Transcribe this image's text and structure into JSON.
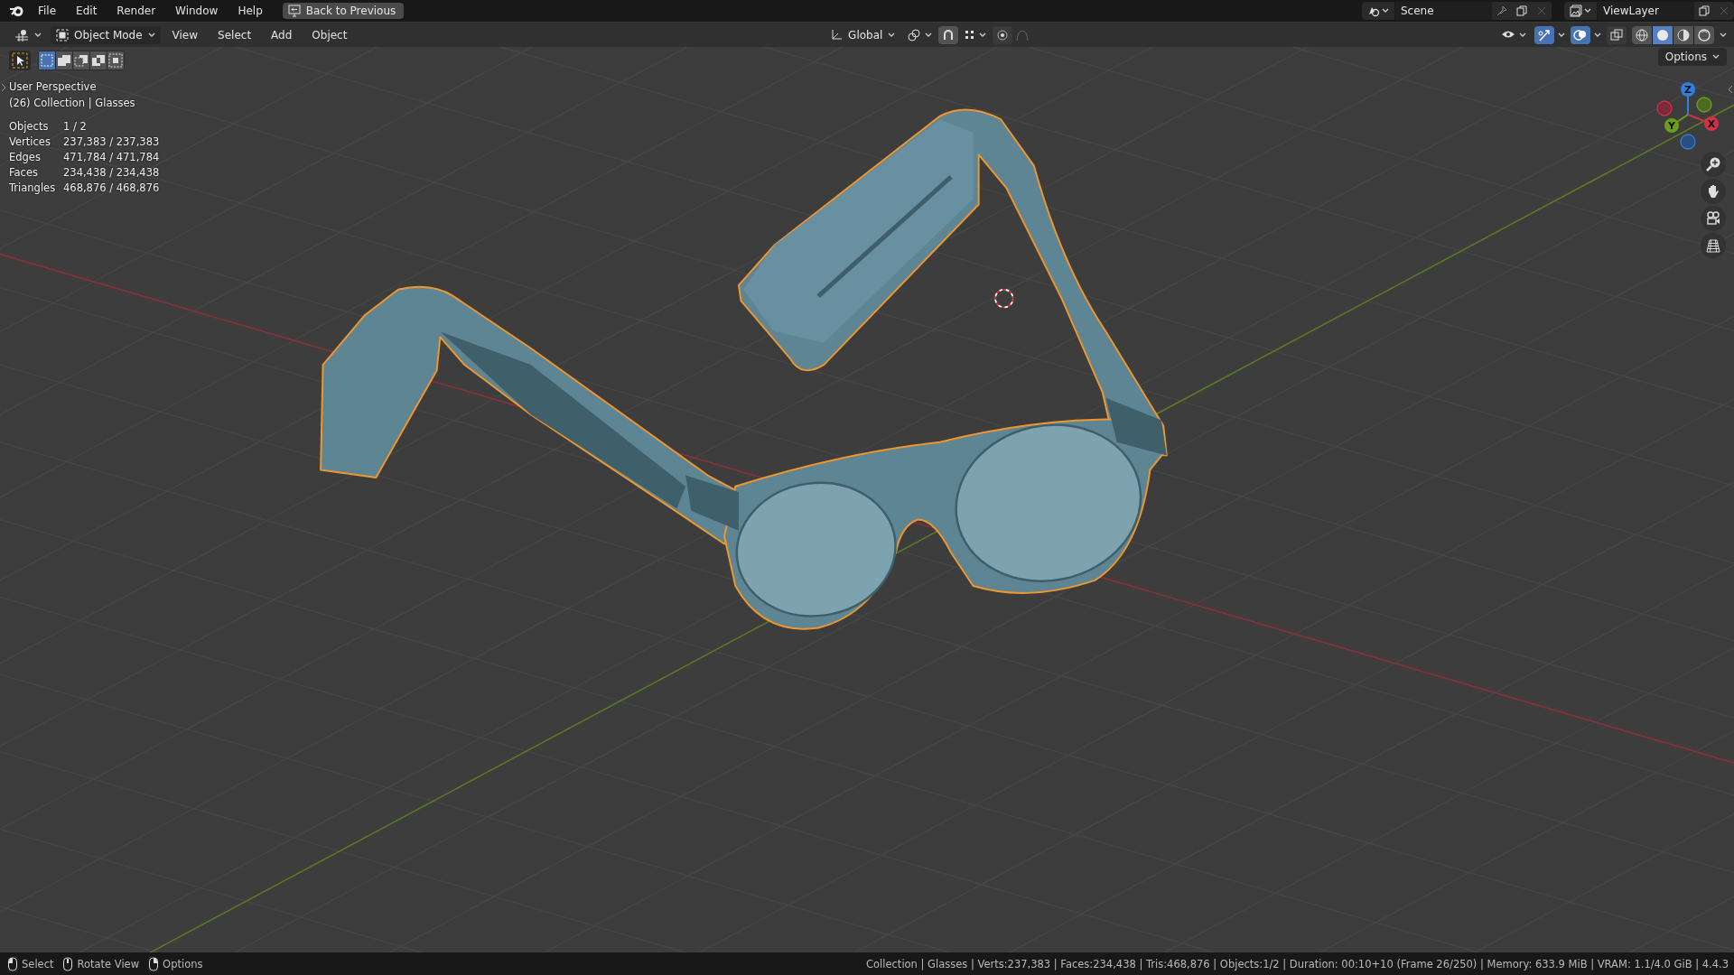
{
  "app_menu": {
    "items": [
      "File",
      "Edit",
      "Render",
      "Window",
      "Help"
    ]
  },
  "back_button": "Back to Previous",
  "scene": {
    "name": "Scene"
  },
  "view_layer": {
    "name": "ViewLayer"
  },
  "header": {
    "mode": "Object Mode",
    "menus": [
      "View",
      "Select",
      "Add",
      "Object"
    ],
    "orientation": "Global",
    "viewport_toggles": [
      {
        "kind": "gizmos",
        "on": true
      },
      {
        "kind": "overlays",
        "on": true
      },
      {
        "kind": "xray",
        "on": false
      }
    ],
    "shading": [
      {
        "kind": "wireframe",
        "selected": false
      },
      {
        "kind": "solid",
        "selected": true
      },
      {
        "kind": "material",
        "selected": false
      },
      {
        "kind": "rendered",
        "selected": false
      }
    ]
  },
  "select_modes": [
    {
      "kind": "set",
      "selected": true
    },
    {
      "kind": "extend",
      "selected": false
    },
    {
      "kind": "subtract",
      "selected": false
    },
    {
      "kind": "difference",
      "selected": false
    },
    {
      "kind": "intersect",
      "selected": false
    }
  ],
  "overlay": {
    "title": "User Perspective",
    "context": "(26) Collection | Glasses",
    "stats": [
      {
        "label": "Objects",
        "value": "1 / 2"
      },
      {
        "label": "Vertices",
        "value": "237,383 / 237,383"
      },
      {
        "label": "Edges",
        "value": "471,784 / 471,784"
      },
      {
        "label": "Faces",
        "value": "234,438 / 234,438"
      },
      {
        "label": "Triangles",
        "value": "468,876 / 468,876"
      }
    ]
  },
  "gizmo": {
    "axes": [
      {
        "kind": "z",
        "label": "Z"
      },
      {
        "kind": "y",
        "label": "Y"
      },
      {
        "kind": "x",
        "label": "X"
      }
    ]
  },
  "options_button": "Options",
  "viewport": {
    "model": {
      "selected": true
    }
  },
  "status_bar": {
    "hints": [
      {
        "kind": "left",
        "label": "Select"
      },
      {
        "kind": "middle",
        "label": "Rotate View"
      },
      {
        "kind": "right",
        "label": "Options"
      }
    ],
    "info": "Collection | Glasses | Verts:237,383 | Faces:234,438 | Tris:468,876 | Objects:1/2 | Duration: 00:10+10 (Frame 26/250) | Memory: 633.9 MiB | VRAM: 1.1/4.0 GiB | 4.4.3"
  }
}
